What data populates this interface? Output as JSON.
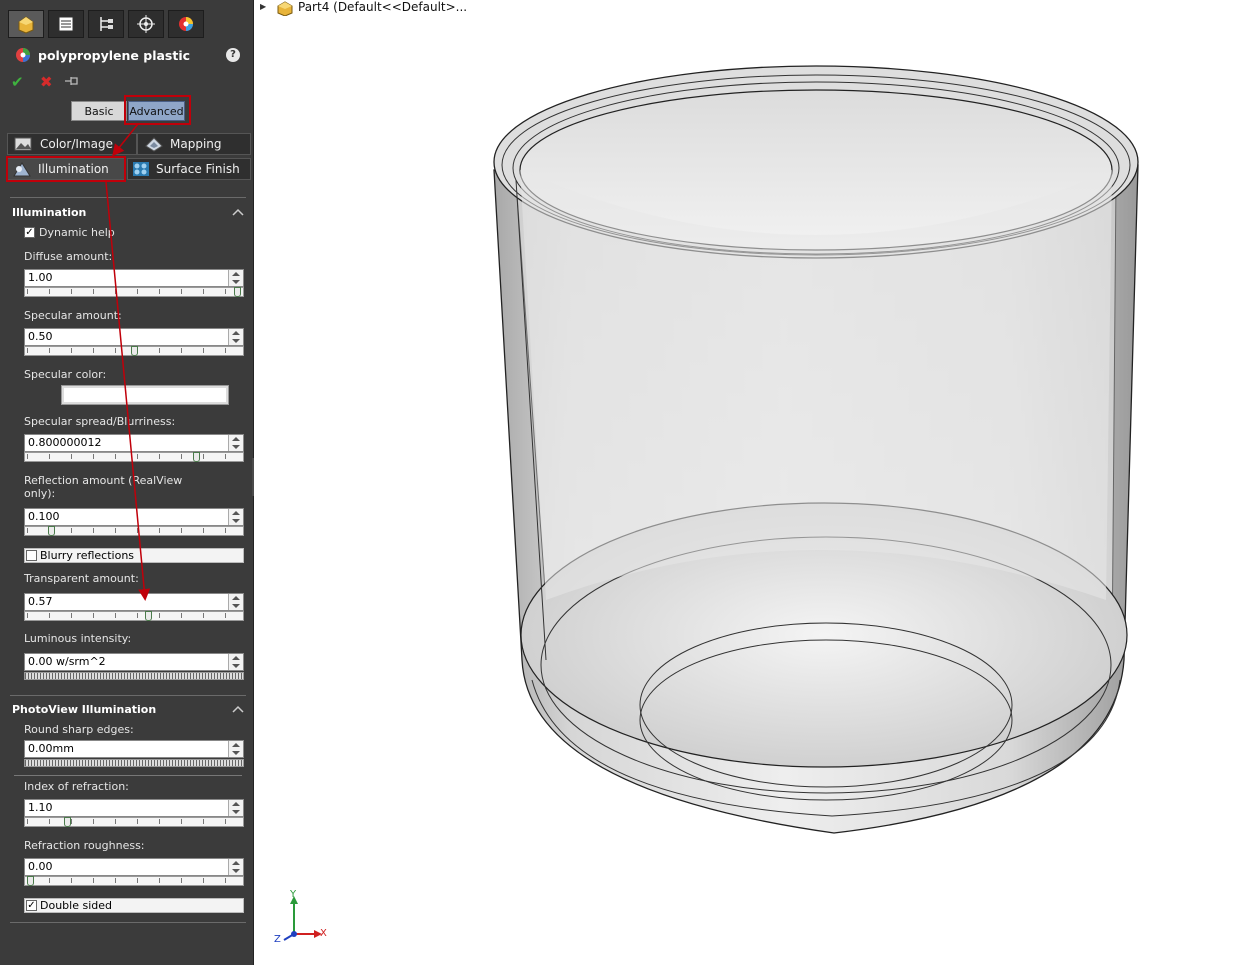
{
  "tree": {
    "label": "Part4  (Default<<Default>..."
  },
  "panel": {
    "tabs_icons": [
      "feature-manager-icon",
      "property-manager-icon",
      "configuration-manager-icon",
      "dimxpert-icon",
      "display-manager-icon"
    ],
    "title": "polypropylene plastic",
    "help": "?",
    "modes": {
      "basic": "Basic",
      "advanced": "Advanced"
    },
    "subtabs": {
      "color_image": "Color/Image",
      "mapping": "Mapping",
      "illumination": "Illumination",
      "surface_finish": "Surface Finish"
    },
    "illumination": {
      "header": "Illumination",
      "dynamic_help": "Dynamic help",
      "dynamic_help_checked": true,
      "diffuse_label": "Diffuse amount:",
      "diffuse_value": "1.00",
      "diffuse_level": 1.0,
      "specular_label": "Specular amount:",
      "specular_value": "0.50",
      "specular_level": 0.5,
      "specular_color_label": "Specular color:",
      "specular_color": "#ffffff",
      "spread_label": "Specular spread/Blurriness:",
      "spread_value": "0.800000012",
      "spread_level": 0.8,
      "reflection_label": "Reflection amount (RealView only):",
      "reflection_value": "0.100",
      "reflection_level": 0.1,
      "blurry_label": "Blurry reflections",
      "blurry_checked": false,
      "transparent_label": "Transparent amount:",
      "transparent_value": "0.57",
      "transparent_level": 0.57,
      "luminous_label": "Luminous intensity:",
      "luminous_value": "0.00 w/srm^2"
    },
    "photoview": {
      "header": "PhotoView Illumination",
      "round_label": "Round sharp edges:",
      "round_value": "0.00mm",
      "refraction_label": "Index of refraction:",
      "refraction_value": "1.10",
      "refraction_level": 0.18,
      "roughness_label": "Refraction roughness:",
      "roughness_value": "0.00",
      "roughness_level": 0.0,
      "double_label": "Double sided",
      "double_checked": true
    }
  },
  "triad": {
    "x": "X",
    "y": "Y",
    "z": "Z"
  },
  "colors": {
    "panel_bg": "#3b3b3b",
    "highlight": "#c0000a",
    "active_mode": "#8fa6c8"
  }
}
